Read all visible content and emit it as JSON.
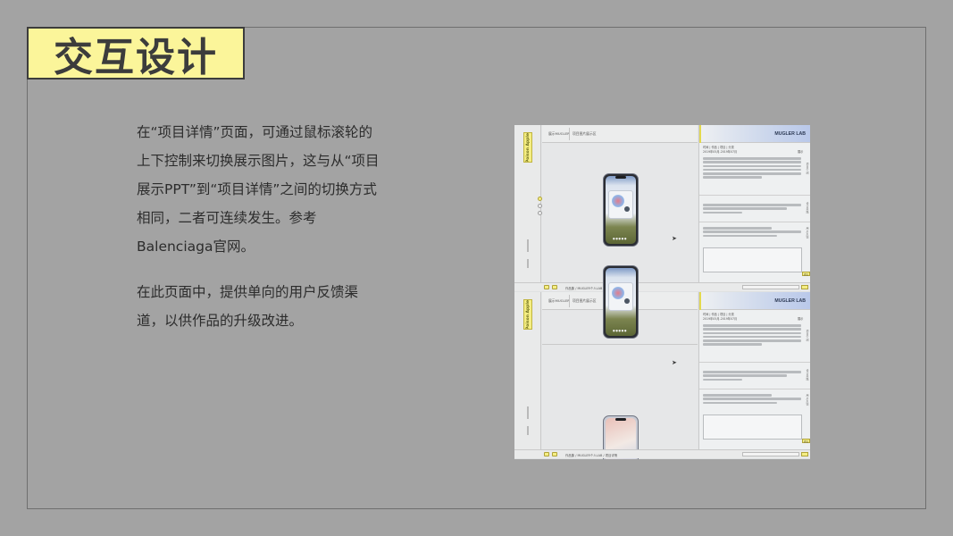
{
  "title": "交互设计",
  "description": {
    "paragraph1": "在“项目详情”页面，可通过鼠标滚轮的上下控制来切换展示图片，这与从“项目展示PPT”到“项目详情”之间的切换方式相同，二者可连续发生。参考Balenciaga官网。",
    "paragraph2": "在此页面中，提供单向的用户反馈渠道，以供作品的升级改进。"
  },
  "mockup": {
    "brand_vertical": "Poison Apple",
    "canvas_tab1": "展示MUGLER",
    "canvas_tab2": "项目图片展示区",
    "project_name": "MUGLER LAB",
    "meta_line1": "时间  |  作品  |  项目  |  分类",
    "meta_line2": "2019年05月-2019年07月",
    "meta_tag": "展示",
    "breadcrumb": "作品集  /  MUGLER个人LAB  /  项目详情",
    "send_label": "提交",
    "section_labels": [
      "项目介绍",
      "设计思路",
      "用户反馈"
    ],
    "accent_color": "#f5ee83",
    "background_color": "#a3a3a3"
  }
}
